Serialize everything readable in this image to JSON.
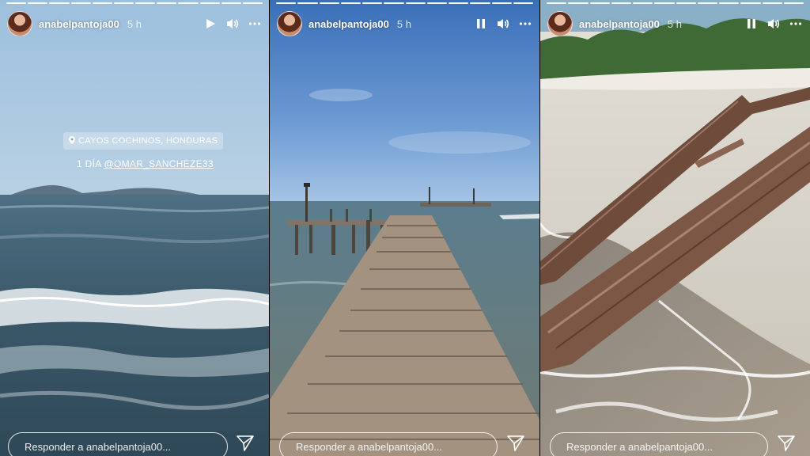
{
  "stories": [
    {
      "username": "anabelpantoja00",
      "time": "5 h",
      "playback": "play",
      "reply_placeholder": "Responder a anabelpantoja00...",
      "progress_total": 12,
      "progress_current": 12,
      "location_tag": "CAYOS COCHINOS, HONDURAS",
      "mention_prefix": "1 DÍA",
      "mention_handle": "@OMAR_SANCHEZE33"
    },
    {
      "username": "anabelpantoja00",
      "time": "5 h",
      "playback": "pause",
      "reply_placeholder": "Responder a anabelpantoja00...",
      "progress_total": 12,
      "progress_current": 12
    },
    {
      "username": "anabelpantoja00",
      "time": "5 h",
      "playback": "pause",
      "reply_placeholder": "Responder a anabelpantoja00...",
      "progress_total": 12,
      "progress_current": 12
    }
  ],
  "icons": {
    "play": "play-icon",
    "pause": "pause-icon",
    "volume": "volume-icon",
    "more": "more-options-icon",
    "send": "send-icon",
    "location": "location-pin-icon"
  },
  "colors": {
    "sky_top": "#8fb6d8",
    "sea": "#3d5f73",
    "pier_wood": "#a08f77",
    "sand": "#d9d6cf",
    "log": "#7d5745"
  }
}
